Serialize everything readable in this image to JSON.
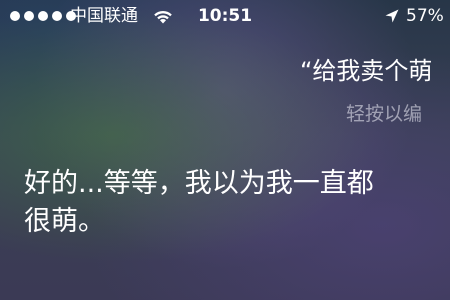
{
  "status_bar": {
    "carrier": "中国联通",
    "time": "10:51",
    "battery": "57%"
  },
  "siri": {
    "user_query": "“给我卖个萌",
    "edit_hint": "轻按以编",
    "response_lines": [
      "好的...等等，我以为我一直都",
      "很萌。"
    ]
  },
  "icons": [
    "signal-dots-icon",
    "wifi-icon",
    "location-arrow-icon"
  ]
}
